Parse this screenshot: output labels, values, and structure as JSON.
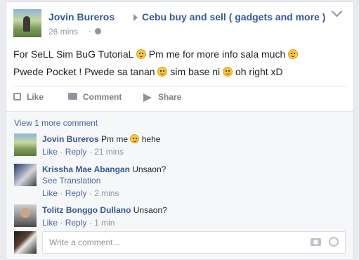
{
  "post": {
    "author": "Jovin Bureros",
    "group": "Cebu buy and sell ( gadgets and more )",
    "timestamp": "26 mins",
    "separator": "·",
    "body": {
      "line1_a": "For SeLL Sim BuG TutoriaL",
      "line1_b": "Pm me for more info sala much",
      "line2_a": "Pwede Pocket ! Pwede sa tanan",
      "line2_b": "sim base ni",
      "line2_c": "oh right xD"
    },
    "actions": {
      "like": "Like",
      "comment": "Comment",
      "share": "Share"
    }
  },
  "comments": {
    "view_more": "View 1 more comment",
    "items": [
      {
        "name": "Jovin Bureros",
        "text_a": "Pm me",
        "text_b": "hehe",
        "like": "Like",
        "reply": "Reply",
        "time": "21 mins",
        "sep": "·"
      },
      {
        "name": "Krissha Mae Abangan",
        "text": "Unsaon?",
        "see_translation": "See Translation",
        "like": "Like",
        "reply": "Reply",
        "time": "2 mins",
        "sep": "·"
      },
      {
        "name": "Tolitz Bonggo Dullano",
        "text": "Unsaon?",
        "like": "Like",
        "reply": "Reply",
        "time": "1 min",
        "sep": "·"
      }
    ],
    "write_placeholder": "Write a comment..."
  },
  "colors": {
    "link": "#365899",
    "meta": "#90949c",
    "text": "#1d2129",
    "background": "#e9ebee"
  },
  "icons": [
    "group-arrow-icon",
    "globe-icon",
    "chevron-down-icon",
    "smiley-emoji-icon",
    "like-icon",
    "comment-icon",
    "share-icon",
    "camera-icon",
    "sticker-icon"
  ]
}
